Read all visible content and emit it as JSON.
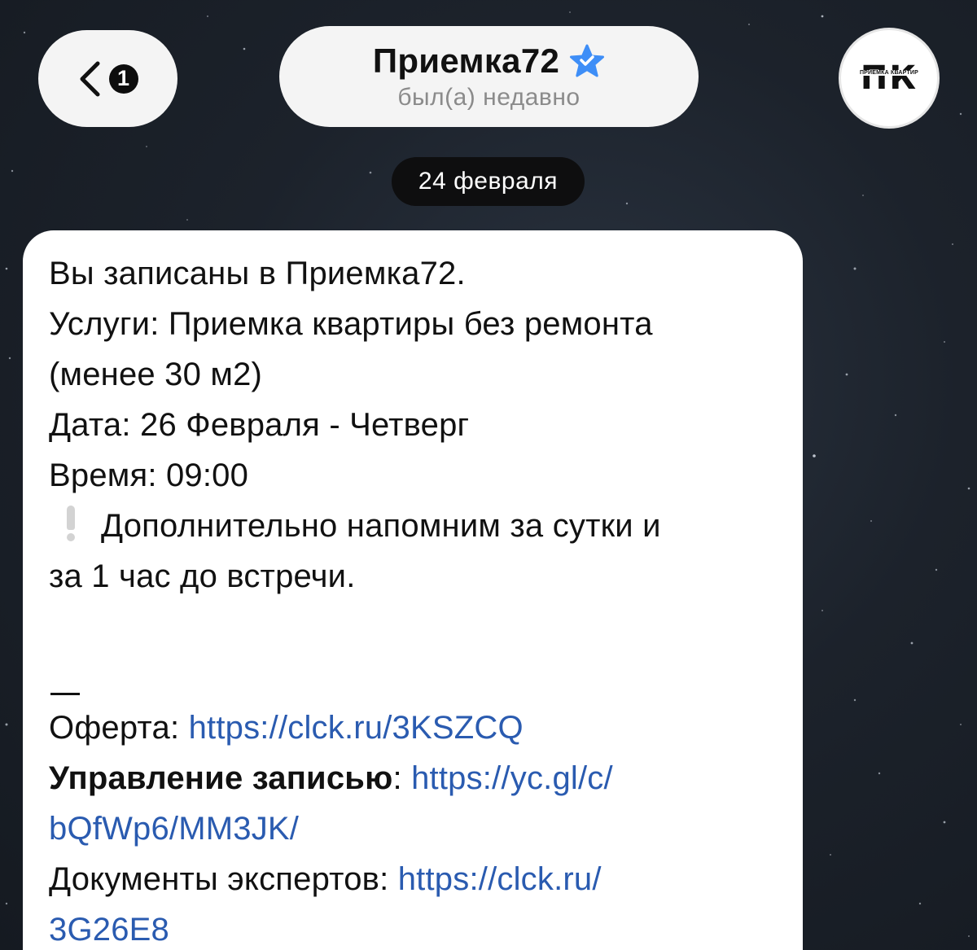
{
  "header": {
    "back_badge_count": "1",
    "chat_title": "Приемка72",
    "chat_status": "был(а) недавно",
    "avatar_letters": "ПК",
    "avatar_caption": "ПРИЕМКА КВАРТИР",
    "verified_icon": "star-badge-icon",
    "verified_color": "#3e8ef7"
  },
  "date_separator": "24 февраля",
  "message": {
    "line1": "Вы записаны в Приемка72.",
    "line2": "Услуги: Приемка квартиры без ремонта",
    "line3": "(менее 30 м2)",
    "line4": "Дата: 26 Февраля - Четверг",
    "line5": "Время: 09:00",
    "line6": "Дополнительно напомним за сутки и",
    "line7": "за 1 час до встречи.",
    "offer_label": "Оферта: ",
    "offer_link": "https://clck.ru/3KSZCQ",
    "manage_label": "Управление записью",
    "manage_sep": ": ",
    "manage_link_part1": "https://yc.gl/c/",
    "manage_link_part2": "bQfWp6/MM3JK/",
    "docs_label": "Документы экспертов: ",
    "docs_link_part1": "https://clck.ru/",
    "docs_link_part2": "3G26E8"
  },
  "colors": {
    "link": "#2a5bb0",
    "bubble": "#ffffff",
    "background": "#1c222b"
  }
}
